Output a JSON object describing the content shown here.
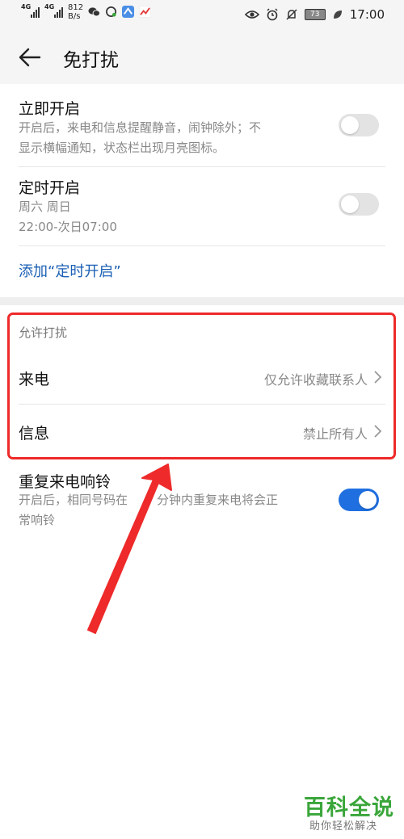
{
  "status_bar": {
    "signal1": "4G",
    "signal2": "4G",
    "net_speed_value": "812",
    "net_speed_unit": "B/s",
    "battery": "73",
    "time": "17:00"
  },
  "header": {
    "title": "免打扰"
  },
  "immediate": {
    "title": "立即开启",
    "desc_line1": "开启后，来电和信息提醒静音，闹钟除外；不",
    "desc_line2": "显示横幅通知，状态栏出现月亮图标。",
    "toggle_on": false
  },
  "scheduled": {
    "title": "定时开启",
    "days": "周六 周日",
    "time_range": "22:00-次日07:00",
    "toggle_on": false
  },
  "add_schedule_label": "添加“定时开启”",
  "allow_section": {
    "label": "允许打扰",
    "calls_label": "来电",
    "calls_value": "仅允许收藏联系人",
    "messages_label": "信息",
    "messages_value": "禁止所有人"
  },
  "repeat_calls": {
    "title": "重复来电响铃",
    "desc_line1": "开启后，相同号码在",
    "desc_line1_end": "分钟内重复来电将会正",
    "desc_line2": "常响铃",
    "toggle_on": true
  },
  "watermark": {
    "title": "百科全说",
    "subtitle": "助你轻松解决"
  },
  "colors": {
    "accent": "#1f6fe0",
    "annotation": "#ee2a2a",
    "watermark": "#3aa63a"
  }
}
